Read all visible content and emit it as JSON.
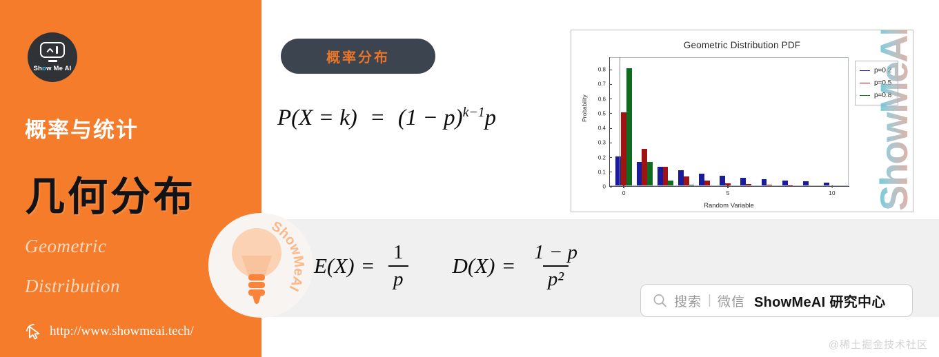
{
  "brand": {
    "logo_name": "Show Me AI",
    "logo_text_pre": "Sh",
    "logo_text_eye": "o",
    "logo_text_post": "w Me AI",
    "url": "http://www.showmeai.tech/",
    "watermark_text": "ShowMeAI",
    "chart_watermark_text": "ShowMeAI"
  },
  "left_panel": {
    "kicker": "概率与统计",
    "headline": "几何分布",
    "subtitle_line1": "Geometric",
    "subtitle_line2": "Distribution",
    "background_color": "#f57c2a"
  },
  "badge": {
    "label": "概率分布",
    "background_color": "#3c444f",
    "text_color": "#e8762a"
  },
  "formulas": {
    "pmf": {
      "lhs": "P(X = k)",
      "eq": "=",
      "rhs_base": "(1 − p)",
      "rhs_exp": "k−1",
      "rhs_tail": "p",
      "plain": "P(X = k) = (1 − p)^(k−1) p"
    },
    "expectation": {
      "lhs": "E(X)",
      "eq": "=",
      "numerator": "1",
      "denominator": "p",
      "plain": "E(X) = 1/p"
    },
    "variance": {
      "lhs": "D(X)",
      "eq": "=",
      "numerator": "1 − p",
      "denominator": "p²",
      "plain": "D(X) = (1 − p)/p²"
    }
  },
  "search": {
    "icon": "search-icon",
    "hint": "搜索",
    "separator": "|",
    "channel": "微信",
    "brand": "ShowMeAI 研究中心"
  },
  "attribution": "@稀土掘金技术社区",
  "chart_data": {
    "type": "bar",
    "title": "Geometric Distribution PDF",
    "xlabel": "Random Variable",
    "ylabel": "Probability",
    "x": [
      0,
      1,
      2,
      3,
      4,
      5,
      6,
      7,
      8,
      9,
      10
    ],
    "xticks": [
      "0",
      "5",
      "10"
    ],
    "xtick_values": [
      0,
      5,
      10
    ],
    "yticks": [
      "0",
      "0.1",
      "0.2",
      "0.3",
      "0.4",
      "0.5",
      "0.6",
      "0.7",
      "0.8"
    ],
    "ytick_values": [
      0,
      0.1,
      0.2,
      0.3,
      0.4,
      0.5,
      0.6,
      0.7,
      0.8
    ],
    "xlim": [
      -0.7,
      10.8
    ],
    "ylim": [
      0,
      0.88
    ],
    "grid": false,
    "legend_position": "upper right",
    "series": [
      {
        "name": "p=0.2",
        "color": "#1b1b9e",
        "values": [
          0.2,
          0.16,
          0.128,
          0.102,
          0.082,
          0.066,
          0.052,
          0.042,
          0.034,
          0.027,
          0.021
        ]
      },
      {
        "name": "p=0.5",
        "color": "#9e1414",
        "values": [
          0.5,
          0.25,
          0.125,
          0.063,
          0.031,
          0.016,
          0.008,
          0.004,
          0.002,
          0.001,
          0.0
        ]
      },
      {
        "name": "p=0.8",
        "color": "#0f6b1e",
        "values": [
          0.8,
          0.16,
          0.032,
          0.006,
          0.001,
          0.0,
          0.0,
          0.0,
          0.0,
          0.0,
          0.0
        ]
      }
    ]
  }
}
